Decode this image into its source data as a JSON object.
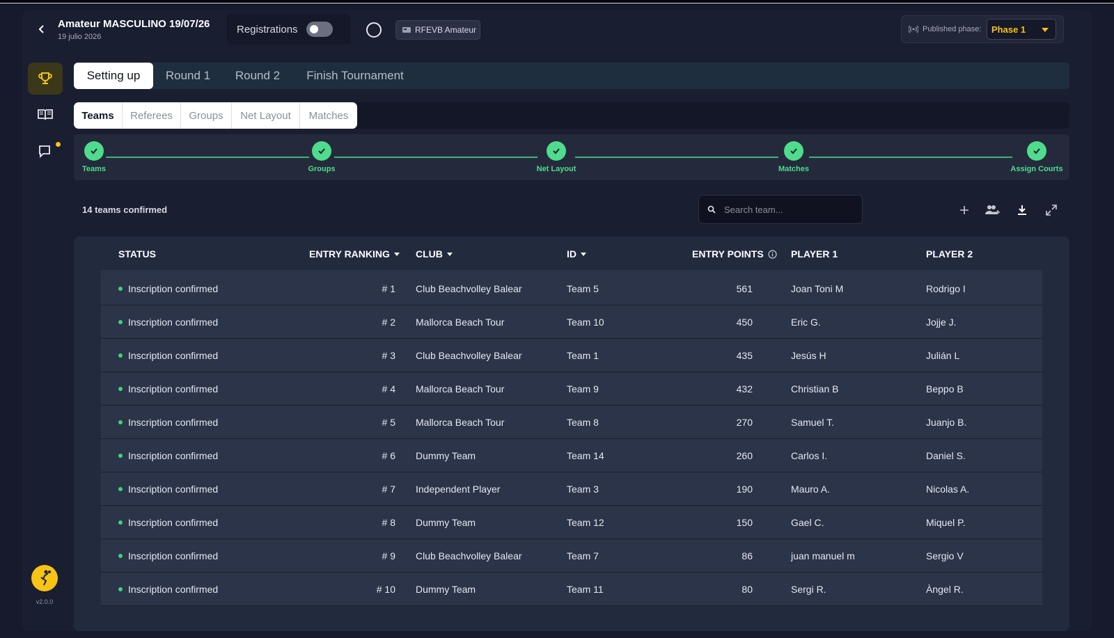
{
  "header": {
    "title": "Amateur MASCULINO 19/07/26",
    "subtitle": "19 julio 2026",
    "registrations_label": "Registrations",
    "federation_label": "RFEVB Amateur",
    "published_phase_label": "Published phase:",
    "phase_value": "Phase 1"
  },
  "phase_tabs": [
    "Setting up",
    "Round 1",
    "Round 2",
    "Finish Tournament"
  ],
  "sub_tabs": [
    "Teams",
    "Referees",
    "Groups",
    "Net Layout",
    "Matches"
  ],
  "steps": [
    "Teams",
    "Groups",
    "Net Layout",
    "Matches",
    "Assign Courts"
  ],
  "toolbar": {
    "count": "14 teams confirmed",
    "search_placeholder": "Search team..."
  },
  "table": {
    "columns": [
      "STATUS",
      "ENTRY RANKING",
      "CLUB",
      "ID",
      "ENTRY POINTS",
      "PLAYER 1",
      "PLAYER 2"
    ],
    "rows": [
      {
        "status": "Inscription confirmed",
        "rank": "# 1",
        "club": "Club Beachvolley Balear",
        "id": "Team 5",
        "points": "561",
        "p1": "Joan Toni M",
        "p2": "Rodrigo I"
      },
      {
        "status": "Inscription confirmed",
        "rank": "# 2",
        "club": "Mallorca Beach Tour",
        "id": "Team 10",
        "points": "450",
        "p1": "Eric G.",
        "p2": "Jojje J."
      },
      {
        "status": "Inscription confirmed",
        "rank": "# 3",
        "club": "Club Beachvolley Balear",
        "id": "Team 1",
        "points": "435",
        "p1": "Jesús H",
        "p2": "Julián L"
      },
      {
        "status": "Inscription confirmed",
        "rank": "# 4",
        "club": "Mallorca Beach Tour",
        "id": "Team 9",
        "points": "432",
        "p1": "Christian B",
        "p2": "Beppo B"
      },
      {
        "status": "Inscription confirmed",
        "rank": "# 5",
        "club": "Mallorca Beach Tour",
        "id": "Team 8",
        "points": "270",
        "p1": "Samuel T.",
        "p2": "Juanjo B."
      },
      {
        "status": "Inscription confirmed",
        "rank": "# 6",
        "club": "Dummy Team",
        "id": "Team 14",
        "points": "260",
        "p1": "Carlos I.",
        "p2": "Daniel S."
      },
      {
        "status": "Inscription confirmed",
        "rank": "# 7",
        "club": "Independent Player",
        "id": "Team 3",
        "points": "190",
        "p1": "Mauro A.",
        "p2": "Nicolas A."
      },
      {
        "status": "Inscription confirmed",
        "rank": "# 8",
        "club": "Dummy Team",
        "id": "Team 12",
        "points": "150",
        "p1": "Gael C.",
        "p2": "Miquel P."
      },
      {
        "status": "Inscription confirmed",
        "rank": "# 9",
        "club": "Club Beachvolley Balear",
        "id": "Team 7",
        "points": "86",
        "p1": "juan manuel m",
        "p2": "Sergio  V"
      },
      {
        "status": "Inscription confirmed",
        "rank": "# 10",
        "club": "Dummy Team",
        "id": "Team 11",
        "points": "80",
        "p1": "Sergi R.",
        "p2": "Àngel R."
      }
    ]
  },
  "sidebar": {
    "icons": [
      "trophy-icon",
      "book-icon",
      "chat-icon"
    ],
    "version": "v2.0.0"
  },
  "colors": {
    "accent": "#f7c415",
    "success": "#4fdc8d"
  }
}
